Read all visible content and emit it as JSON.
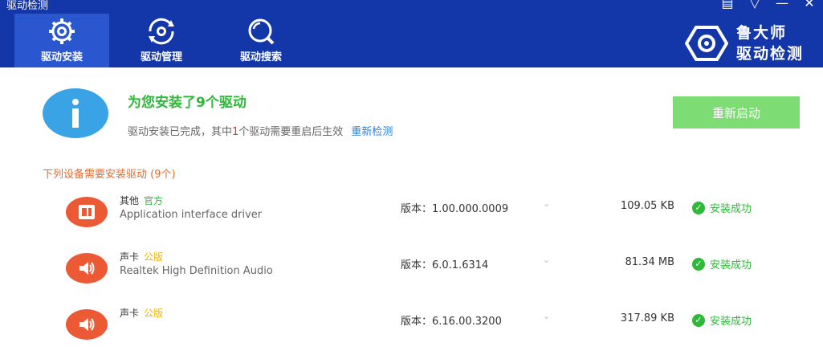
{
  "window": {
    "title": "驱动检测",
    "controls": [
      "feedback-icon",
      "menu-icon",
      "minimize-icon",
      "close-icon"
    ]
  },
  "tabs": [
    {
      "label": "驱动安装",
      "icon": "gear-icon",
      "active": true
    },
    {
      "label": "驱动管理",
      "icon": "refresh-gear-icon",
      "active": false
    },
    {
      "label": "驱动搜索",
      "icon": "search-icon",
      "active": false
    }
  ],
  "brand": {
    "line1": "鲁大师",
    "line2": "驱动检测"
  },
  "summary": {
    "headline": "为您安装了9个驱动",
    "sub_pre": "驱动安装已完成，其中",
    "sub_num": "1",
    "sub_post": "个驱动需要重启后生效",
    "link": "重新检测",
    "restart_button": "重新启动"
  },
  "section_title": "下列设备需要安装驱动 (9个)",
  "drivers": [
    {
      "category": "其他",
      "tag": "官方",
      "tag_color": "#2fb83a",
      "name": "Application interface driver",
      "version": "版本：1.00.000.0009",
      "size": "109.05 KB",
      "status": "安装成功",
      "icon": "chip-icon"
    },
    {
      "category": "声卡",
      "tag": "公版",
      "tag_color": "#f0b400",
      "name": "Realtek High Definition Audio",
      "version": "版本：6.0.1.6314",
      "size": "81.34 MB",
      "status": "安装成功",
      "icon": "speaker-icon"
    },
    {
      "category": "声卡",
      "tag": "公版",
      "tag_color": "#f0b400",
      "name": "",
      "version": "版本：6.16.00.3200",
      "size": "317.89 KB",
      "status": "安装成功",
      "icon": "speaker-icon"
    }
  ],
  "colors": {
    "header": "#1337a8",
    "accent_green": "#2fb83a",
    "button_green": "#7edc74",
    "icon_orange": "#eb5a35"
  }
}
